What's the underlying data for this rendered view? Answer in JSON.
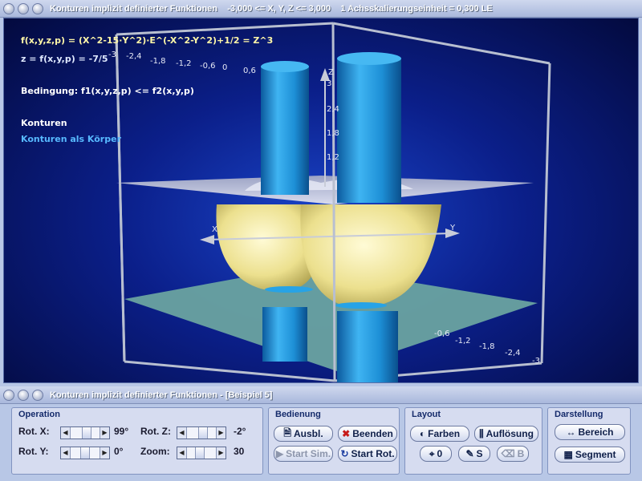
{
  "windows": {
    "top_title": "Konturen implizit definierter Funktionen    -3,000 <= X, Y, Z <= 3,000    1 Achsskalierungseinheit = 0,300 LE",
    "bottom_title": "Konturen implizit definierter Funktionen - [Beispiel 5]"
  },
  "viewport": {
    "formula_f": "f(x,y,z,p) = (X^2-15·Y^2)·E^(-X^2-Y^2)+1/2 = Z^3",
    "formula_z": "z = f(x,y,p) = -7/5",
    "condition": "Bedingung: f1(x,y,z,p) <= f2(x,y,p)",
    "konturen": "Konturen",
    "konturen_koerper": "Konturen als Körper",
    "axis_x": "X",
    "axis_y": "Y",
    "axis_z": "Z",
    "ticks_top": [
      "-3",
      "-2,4",
      "-1,8",
      "-1,2",
      "-0,6",
      "0",
      "0,6"
    ],
    "ticks_z": [
      "3",
      "2,4",
      "1,8",
      "1,2"
    ],
    "ticks_bottom": [
      "-0,6",
      "-1,2",
      "-1,8",
      "-2,4",
      "-3"
    ]
  },
  "panel": {
    "operation": {
      "title": "Operation",
      "rot_x_label": "Rot. X:",
      "rot_x_value": "99°",
      "rot_y_label": "Rot. Y:",
      "rot_y_value": "0°",
      "rot_z_label": "Rot. Z:",
      "rot_z_value": "-2°",
      "zoom_label": "Zoom:",
      "zoom_value": "30"
    },
    "bedienung": {
      "title": "Bedienung",
      "ausbl": "Ausbl.",
      "beenden": "Beenden",
      "start_sim": "Start Sim.",
      "start_rot": "Start Rot."
    },
    "layout": {
      "title": "Layout",
      "farben": "Farben",
      "aufloesung": "Auflösung",
      "o": "0",
      "s": "S",
      "b": "B"
    },
    "darstellung": {
      "title": "Darstellung",
      "bereich": "Bereich",
      "segment": "Segment"
    }
  },
  "colors": {
    "viewport_bg": "#0b1f8a",
    "cylinder": "#1d8fd6",
    "surface": "#f3eaa3",
    "plane": "#6aa3a0",
    "formula_text": "#fff7a8",
    "contour_body_text": "#57b9ff"
  }
}
